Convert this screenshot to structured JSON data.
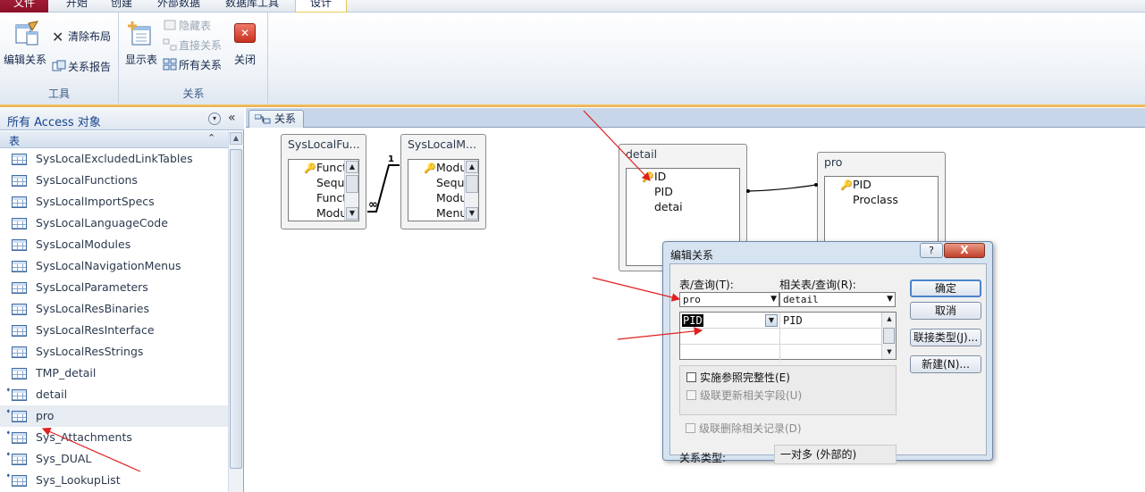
{
  "ribbon_tabs": [
    "文件",
    "开始",
    "创建",
    "外部数据",
    "数据库工具",
    "设计"
  ],
  "ribbon": {
    "tools_group": {
      "label": "工具",
      "edit_relationships": "编辑关系",
      "clear_layout": "清除布局",
      "relationship_report": "关系报告"
    },
    "relationships_group": {
      "label": "关系",
      "show_table": "显示表",
      "hide_table": "隐藏表",
      "direct_relationships": "直接关系",
      "all_relationships": "所有关系",
      "close": "关闭"
    }
  },
  "nav": {
    "title": "所有 Access 对象",
    "category": "表",
    "items": [
      {
        "label": "SysLocalExcludedLinkTables",
        "linked": false
      },
      {
        "label": "SysLocalFunctions",
        "linked": false
      },
      {
        "label": "SysLocalImportSpecs",
        "linked": false
      },
      {
        "label": "SysLocalLanguageCode",
        "linked": false
      },
      {
        "label": "SysLocalModules",
        "linked": false
      },
      {
        "label": "SysLocalNavigationMenus",
        "linked": false
      },
      {
        "label": "SysLocalParameters",
        "linked": false
      },
      {
        "label": "SysLocalResBinaries",
        "linked": false
      },
      {
        "label": "SysLocalResInterface",
        "linked": false
      },
      {
        "label": "SysLocalResStrings",
        "linked": false
      },
      {
        "label": "TMP_detail",
        "linked": false
      },
      {
        "label": "detail",
        "linked": true
      },
      {
        "label": "pro",
        "linked": true
      },
      {
        "label": "Sys_Attachments",
        "linked": true
      },
      {
        "label": "Sys_DUAL",
        "linked": true
      },
      {
        "label": "Sys_LookupList",
        "linked": true
      }
    ]
  },
  "doc_tab": "关系",
  "tables": {
    "t1": {
      "title": "SysLocalFu...",
      "fields": [
        "Functi",
        "Seque",
        "Functi",
        "Modu"
      ]
    },
    "t2": {
      "title": "SysLocalM...",
      "fields": [
        "Modu",
        "Seque",
        "Modu",
        "Menu"
      ]
    },
    "detail": {
      "title": "detail",
      "fields": [
        "ID",
        "PID",
        "detai"
      ]
    },
    "pro": {
      "title": "pro",
      "fields": [
        "PID",
        "Proclass"
      ]
    }
  },
  "relation_labels": {
    "one": "1",
    "many": "∞"
  },
  "dialog": {
    "title": "编辑关系",
    "help": "?",
    "close": "X",
    "table_label": "表/查询(T):",
    "related_label": "相关表/查询(R):",
    "table_value": "pro",
    "related_value": "detail",
    "grid": {
      "left_field": "PID",
      "right_field": "PID"
    },
    "buttons": {
      "ok": "确定",
      "cancel": "取消",
      "join_type": "联接类型(J)...",
      "create_new": "新建(N)..."
    },
    "enforce": "实施参照完整性(E)",
    "cascade_update": "级联更新相关字段(U)",
    "cascade_delete": "级联删除相关记录(D)",
    "relationship_type_label": "关系类型:",
    "relationship_type_value": "一对多 (外部的)"
  },
  "colors": {
    "file_tab": "#8b1028",
    "accent": "#e8a947",
    "annotation_arrow": "#e02020"
  }
}
